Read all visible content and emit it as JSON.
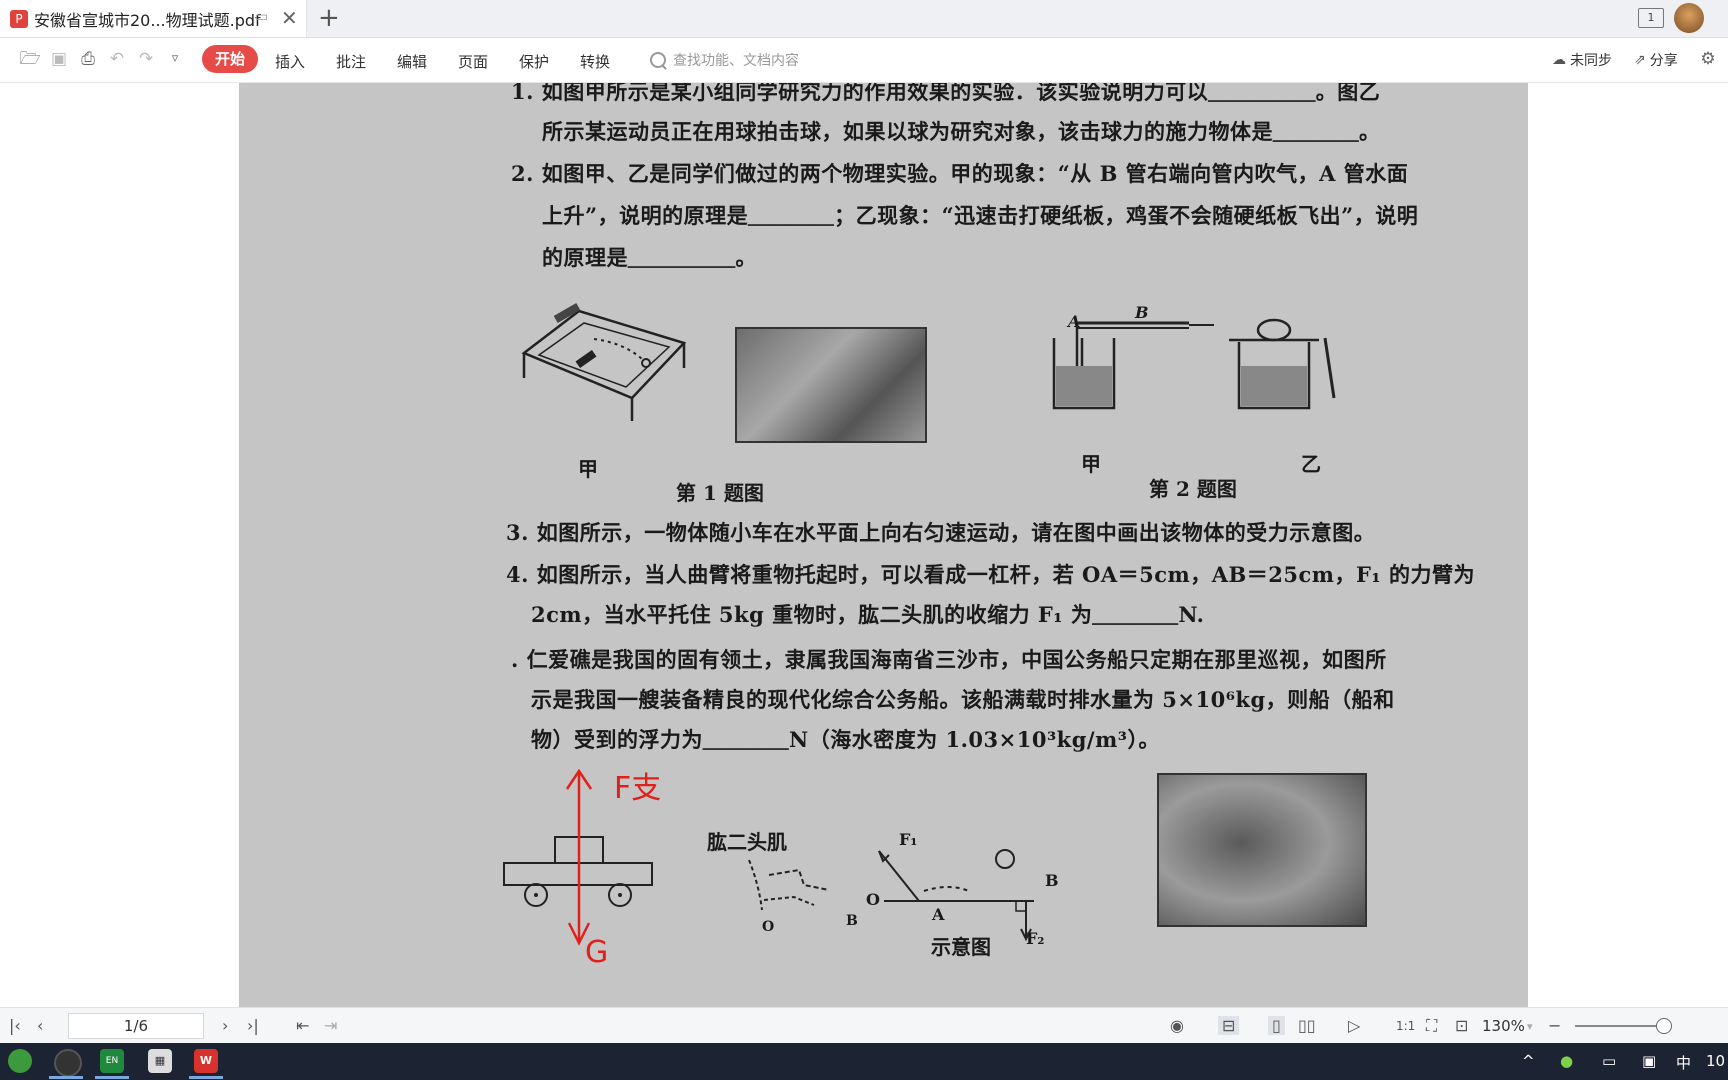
{
  "tabs": {
    "doc_title": "安徽省宣城市20...物理试题.pdf",
    "pdf_badge": "P",
    "new_tab": "+",
    "window_count": "1"
  },
  "toolbar": {
    "menus": [
      "开始",
      "插入",
      "批注",
      "编辑",
      "页面",
      "保护",
      "转换"
    ],
    "search_placeholder": "查找功能、文档内容",
    "sync_label": "未同步",
    "share_label": "分享"
  },
  "document": {
    "q1_line1": "1. 如图甲所示是某小组同学研究力的作用效果的实验．该实验说明力可以＿＿＿＿＿。图乙",
    "q1_line2": "所示某运动员正在用球拍击球，如果以球为研究对象，该击球力的施力物体是＿＿＿＿。",
    "q2_line1": "2. 如图甲、乙是同学们做过的两个物理实验。甲的现象：“从 B 管右端向管内吹气，A 管水面",
    "q2_line2": "上升”，说明的原理是＿＿＿＿；乙现象：“迅速击打硬纸板，鸡蛋不会随硬纸板飞出”，说明",
    "q2_line3": "的原理是＿＿＿＿＿。",
    "fig1_label_jia": "甲",
    "fig1_caption": "第 1 题图",
    "fig2_label_jia": "甲",
    "fig2_label_yi": "乙",
    "fig2_caption": "第 2 题图",
    "fig2_label_A": "A",
    "fig2_label_B": "B",
    "q3_line1": "3. 如图所示，一物体随小车在水平面上向右匀速运动，请在图中画出该物体的受力示意图。",
    "q4_line1": "4. 如图所示，当人曲臂将重物托起时，可以看成一杠杆，若 OA＝5cm，AB＝25cm，F₁ 的力臂为",
    "q4_line2": "2cm，当水平托住 5kg 重物时，肱二头肌的收缩力 F₁ 为＿＿＿＿N.",
    "q5_line1": ". 仁爱礁是我国的固有领土，隶属我国海南省三沙市，中国公务船只定期在那里巡视，如图所",
    "q5_line2": "示是我国一艘装备精良的现代化综合公务船。该船满载时排水量为 5×10⁶kg，则船（船和",
    "q5_line3": "物）受到的浮力为＿＿＿＿N（海水密度为 1.03×10³kg/m³）。",
    "biceps_label": "肱二头肌",
    "lever_O": "O",
    "lever_A": "A",
    "lever_B": "B",
    "lever_F1": "F₁",
    "lever_F2": "F₂",
    "diagram_caption": "示意图",
    "arm_O": "O",
    "arm_B": "B",
    "annot_up": "F支",
    "annot_down": "G"
  },
  "statusbar": {
    "page_indicator": "1/6",
    "zoom": "130%"
  },
  "taskbar": {
    "lang": "中",
    "clock_partial": "10",
    "en_badge": "EN"
  }
}
